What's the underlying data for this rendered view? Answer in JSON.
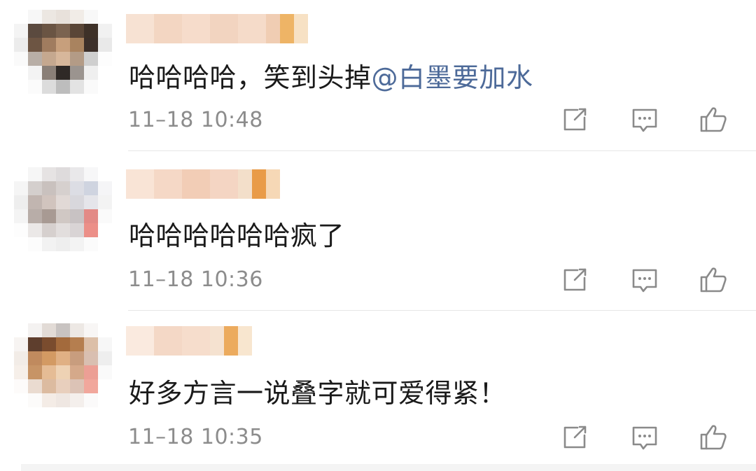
{
  "comments": [
    {
      "text": "哈哈哈哈，笑到头掉",
      "mention": "@白墨要加水",
      "time": "11–18 10:48"
    },
    {
      "text": "哈哈哈哈哈哈疯了",
      "mention": "",
      "time": "11–18 10:36"
    },
    {
      "text": "好多方言一说叠字就可爱得紧！",
      "mention": "",
      "time": "11–18 10:35"
    }
  ],
  "icons": {
    "share": "share-icon",
    "reply": "comment-icon",
    "like": "thumbs-up-icon"
  },
  "colors": {
    "text": "#1a1a1a",
    "mention": "#4d6a99",
    "time": "#8c8c8c",
    "icon": "#8a8a8a",
    "divider": "#e6e6e6"
  }
}
